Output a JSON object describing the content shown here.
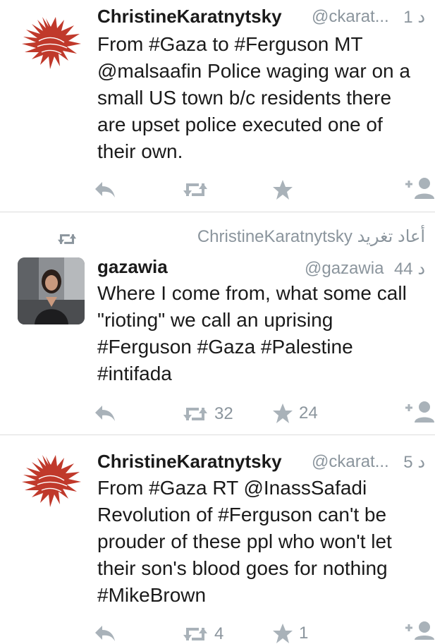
{
  "tweets": [
    {
      "name": "ChristineKaratnytsky",
      "handle": "@ckarat...",
      "time": "1 د",
      "text": "From #Gaza to #Ferguson MT\n@malsaafin Police waging war on a\nsmall US town b/c residents there\nare upset police executed one of\ntheir own.",
      "retweets": "",
      "favorites": "",
      "avatar": "eagle-icon"
    },
    {
      "retweeted_by": "ChristineKaratnytsky أعاد تغريد",
      "name": "gazawia",
      "handle": "@gazawia",
      "time": "44 د",
      "text": "Where I come from, what some call\n\"rioting\" we call an uprising\n#Ferguson #Gaza #Palestine\n#intifada",
      "retweets": "32",
      "favorites": "24",
      "avatar": "woman-photo"
    },
    {
      "name": "ChristineKaratnytsky",
      "handle": "@ckarat...",
      "time": "5 د",
      "text": "From #Gaza RT @InassSafadi\nRevolution of #Ferguson can't be\nprouder of these ppl who won't let\ntheir son's blood goes for nothing\n#MikeBrown",
      "retweets": "4",
      "favorites": "1",
      "avatar": "eagle-icon"
    }
  ],
  "colors": {
    "icon_gray": "#a9b2b9",
    "meta_gray": "#8b959d",
    "eagle_red": "#c0392b",
    "separator": "#dcdcdc"
  }
}
